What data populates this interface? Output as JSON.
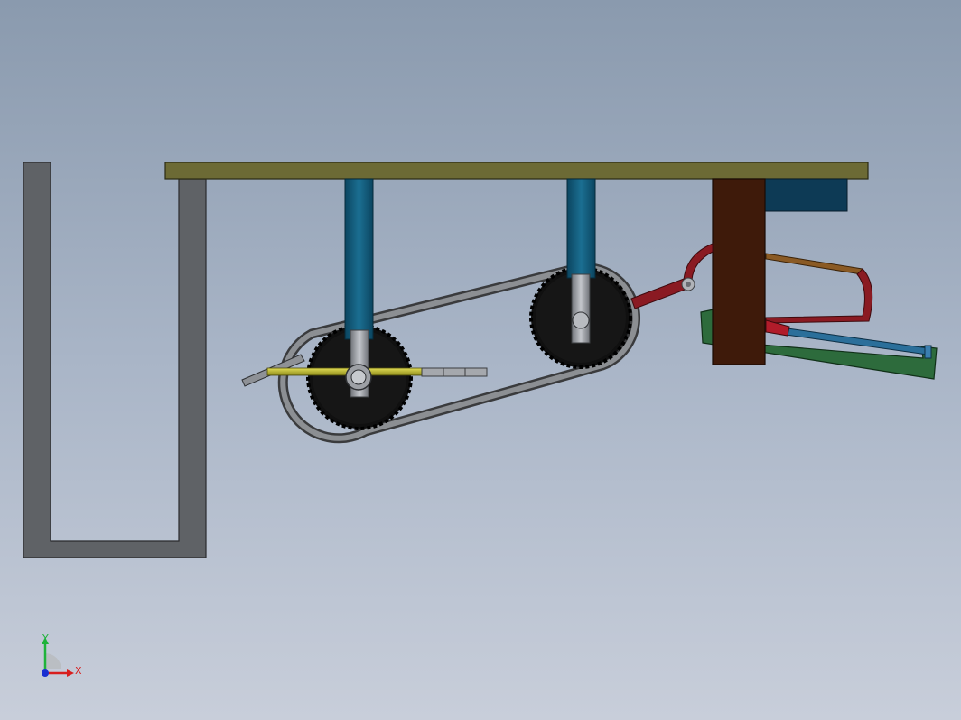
{
  "scene": {
    "description_visible": false,
    "colors": {
      "background_top": "#8a9aae",
      "background_bottom": "#c8ceda",
      "frame": "#5f6266",
      "table_top": "#6c6a35",
      "column": "#0f5a78",
      "sprocket": "#101010",
      "chain": "#6e7073",
      "shaft": "#9a9da3",
      "pedal_rod": "#b6b22a",
      "post": "#3e1a0a",
      "block": "#0d3a55",
      "lever": "#8a1a22",
      "arm": "#8a5a24",
      "tray": "#2d6b3c",
      "rod": "#2b6f9a"
    }
  },
  "triad": {
    "x_label": "X",
    "y_label": "Y",
    "x_color": "#d81e1e",
    "y_color": "#1fb33b",
    "z_color": "#1a2fd1"
  }
}
